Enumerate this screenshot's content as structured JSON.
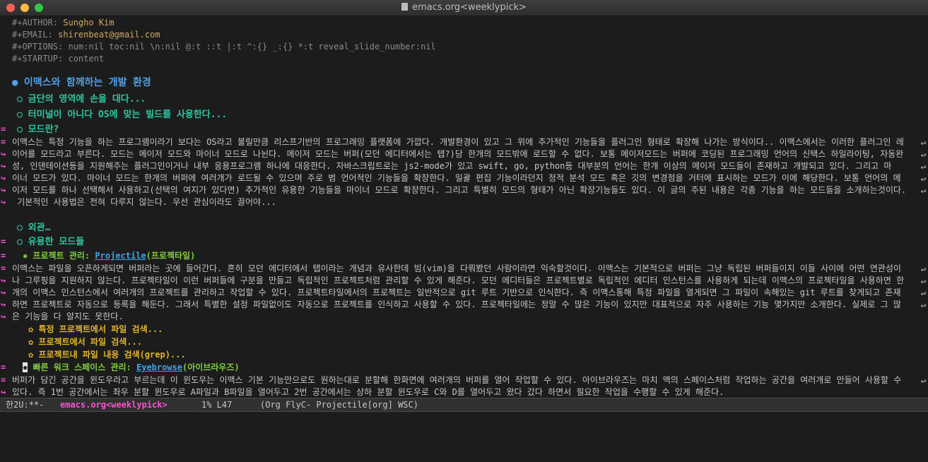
{
  "window": {
    "title": "emacs.org<weeklypick>"
  },
  "buffer": {
    "meta": [
      {
        "key": "#+AUTHOR:",
        "value": " Sungho Kim"
      },
      {
        "key": "#+EMAIL:",
        "value": " shirenbeat@gmail.com"
      },
      {
        "key": "#+OPTIONS:",
        "value": " num:nil toc:nil \\n:nil @:t ::t |:t ^:{} _:{} *:t reveal_slide_number:nil"
      },
      {
        "key": "#+STARTUP:",
        "value": " content"
      }
    ],
    "h1": {
      "bullet": "●",
      "text": "이맥스와 함께하는 개발 환경"
    },
    "h2a": {
      "bullet": "○",
      "text": "금단의 영역에 손을 대다..."
    },
    "h2b": {
      "bullet": "○",
      "text": "터미널이 아니다 OS에 맞는 빌드를 사용한다..."
    },
    "h2c": {
      "bullet": "○",
      "text": "모드란?"
    },
    "para1": [
      "이맥스는 특정 기능을 하는 프로그램이라기 보다는 OS라고 불릴만큼 리스프기반의 프로그래밍 플랫폼에 가깝다. 개발환경이 있고 그 위에 추가적인 기능들을 플러그인 형태로 확장해 나가는 방식이다.. 이맥스에서는 이러한 플러그인 레",
      "이어를 모드라고 부른다. 모드는 메이저 모드와 마이너 모드로 나뉜다. 메이저 모드는 버퍼(모던 에디터에서는 탭?)당 한개의 모드밖에 로드할 수 없다. 보통 메이저모드는 버퍼에 코딩된 프로그래밍 언어의 신택스 하일라이팅, 자동완",
      "성, 인덴테이션등을 지원해주는 플러그인이거나 내부 응용프로그램 하나에 대응한다. 자바스크립트로는 js2-mode가 있고 swift, go, python등 대부분의 언어는 한개 이상의 메이저 모드들이 존재하고 개발되고 있다. 그리고 마",
      "이너 모드가 있다. 마이너 모드는 한개의 버퍼에 여러개가 로드될 수 있으며 주로 범 언어적인 기능들을 확장한다. 일괄 편집 기능이라던지 정적 분석 모드 혹은 깃의 변경점을 거터에 표시하는 모드가 이에 해당한다. 보통 언어의 메",
      "이저 모드를 하나 선택해서 사용하고(선택의 여지가 있다면) 추가적인 유용한 기능들을 마이너 모드로 확장한다. 그리고 특별히 모드의 형태가 아닌 확장기능들도 있다. 이 글의 주된 내용은 각종 기능을 하는 모드들을 소개하는것이다.",
      " 기본적인 사용법은 전혀 다루지 않는다. 우선 관심이라도 끌어야..."
    ],
    "h2d": {
      "bullet": "○",
      "text": "외관…"
    },
    "h2e": {
      "bullet": "○",
      "text": "유용한 모드들"
    },
    "h3a": {
      "bullet": "✸",
      "label": "프로젝트 관리: ",
      "link": "Projectile",
      "suffix": "(프로젝타일)"
    },
    "para2": [
      "이맥스는 파일을 오픈하게되면 버퍼라는 곳에 들어간다. 흔히 모던 에디터에서 탭이라는 개념과 유사한데 빔(vim)을 다뤄봤던 사람이라면 익숙할것이다. 이맥스는 기본적으로 버퍼는 그냥 독립된 버퍼들이지 이들 사이에 어떤 연관성이",
      "나 그루핑을 지원하지 않는다. 프로젝타일이 이런 버퍼들에 구분을 만들고 독립적인 프로젝트처럼 관리할 수 있게 해준다. 모던 에디터들은 프로젝트별로 독립적인 에디터 인스턴스를 사용하게 되는데 이맥스의 프로젝타일을 사용하면 한",
      "개의 이맥스 인스턴스에서 여러개의 프로젝트를 관리하고 작업할 수 있다. 프로젝트타일에서의 프로젝트는 일반적으로 git 루트 기반으로 인식한다. 즉 이맥스통해 특정 파일을 열게되면 그 파일이 속해있는 git 루트를 찾게되고 존재",
      "하면 프로젝트로 자동으로 등록을 해둔다. 그래서 특별한 설정 파일없이도 자동으로 프로젝트를 인식하고 사용할 수 있다. 프로젝타일에는 정말 수 많은 기능이 있지만 대표적으로 자주 사용하는 기능 몇가지만 소개한다. 실제로 그 많",
      "은 기능을 다 알지도 못한다."
    ],
    "h4a": {
      "bullet": "✿",
      "text": "특정 프로젝트에서 파일 검색..."
    },
    "h4b": {
      "bullet": "✿",
      "text": "프로젝트에서 파일 검색..."
    },
    "h4c": {
      "bullet": "✿",
      "text": "프로젝트내 파일 내용 검색(grep)..."
    },
    "h3b": {
      "bullet": "✸",
      "label": "빠른 워크 스페이스 관리: ",
      "link": "Eyebrowse",
      "suffix": "(아이브라우즈)"
    },
    "para3": [
      "버퍼가 담긴 공간을 윈도우라고 부르는데 이 윈도우는 이맥스 기본 기능만으로도 원하는대로 분할해 한화면에 여러개의 버퍼를 열어 작업할 수 있다. 아이브라우즈는 마치 맥의 스페이스처럼 작업하는 공간을 여러개로 만들어 사용할 수",
      "있다. 즉 1번 공간에서는 좌우 분할 윈도우로 A파일과 B파일을 열어두고 2번 공간에서는 상하 분할 윈도우로 C와 D를 열어두고 왔다 갔다 하면서 필요한 작업을 수행할 수 있게 해준다."
    ]
  },
  "modeline": {
    "status": "한2U:**-",
    "buffer_name": "emacs.org<weeklypick>",
    "position": "1% L47",
    "modes": "(Org FlyC- Projectile[org] WSC)"
  },
  "colors": {
    "background": "#1c1c1c",
    "heading1": "#4f9fe6",
    "heading2": "#2ec6a0",
    "heading3": "#7fcf3c",
    "heading4": "#e2b626",
    "link": "#38a6e8",
    "fringe": "#ff4fd2"
  }
}
